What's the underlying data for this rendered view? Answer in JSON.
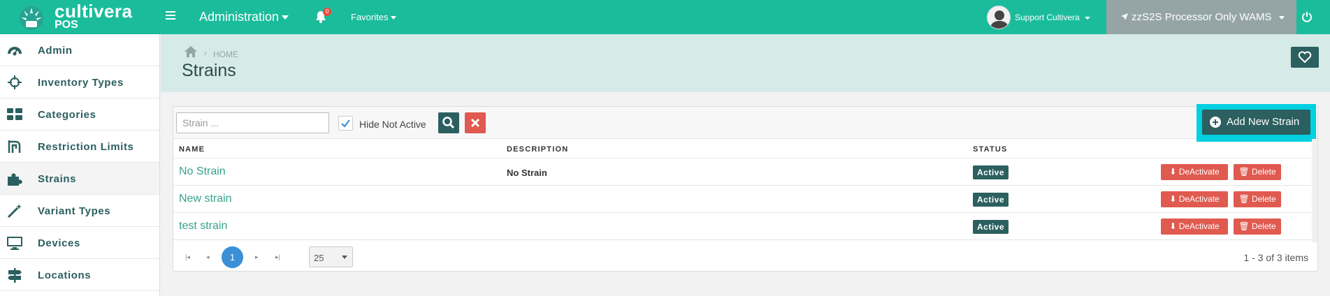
{
  "brand": {
    "name": "cultivera",
    "sub": "POS"
  },
  "topbar": {
    "admin_label": "Administration",
    "notification_count": "0",
    "favorites_label": "Favorites",
    "user_name": "Support Cultivera",
    "location_label": "zzS2S Processor Only WAMS"
  },
  "sidebar": {
    "items": [
      {
        "label": "Admin",
        "icon": "dashboard-icon"
      },
      {
        "label": "Inventory Types",
        "icon": "crosshair-icon"
      },
      {
        "label": "Categories",
        "icon": "grid-icon"
      },
      {
        "label": "Restriction Limits",
        "icon": "restriction-icon"
      },
      {
        "label": "Strains",
        "icon": "puzzle-icon"
      },
      {
        "label": "Variant Types",
        "icon": "magic-wand-icon"
      },
      {
        "label": "Devices",
        "icon": "monitor-icon"
      },
      {
        "label": "Locations",
        "icon": "signpost-icon"
      }
    ]
  },
  "breadcrumb": {
    "separator": "›",
    "home": "HOME"
  },
  "page": {
    "title": "Strains"
  },
  "toolbar": {
    "search_placeholder": "Strain ...",
    "hide_not_active_label": "Hide Not Active",
    "hide_not_active_checked": true,
    "add_label": "Add New Strain"
  },
  "table": {
    "headers": {
      "name": "NAME",
      "description": "DESCRIPTION",
      "status": "STATUS"
    },
    "rows": [
      {
        "name": "No Strain",
        "description": "No Strain",
        "status": "Active",
        "deactivate": "DeActivate",
        "delete": "Delete"
      },
      {
        "name": "New strain",
        "description": "",
        "status": "Active",
        "deactivate": "DeActivate",
        "delete": "Delete"
      },
      {
        "name": "test strain",
        "description": "",
        "status": "Active",
        "deactivate": "DeActivate",
        "delete": "Delete"
      }
    ]
  },
  "pager": {
    "current_page": "1",
    "page_size": "25",
    "info": "1 - 3 of 3 items"
  },
  "colors": {
    "topbar": "#1abc9c",
    "dark_teal": "#2c5f5f",
    "danger": "#e05a4f",
    "link": "#34a38a",
    "page_current": "#3a8fd6",
    "highlight": "#00d0e0"
  }
}
